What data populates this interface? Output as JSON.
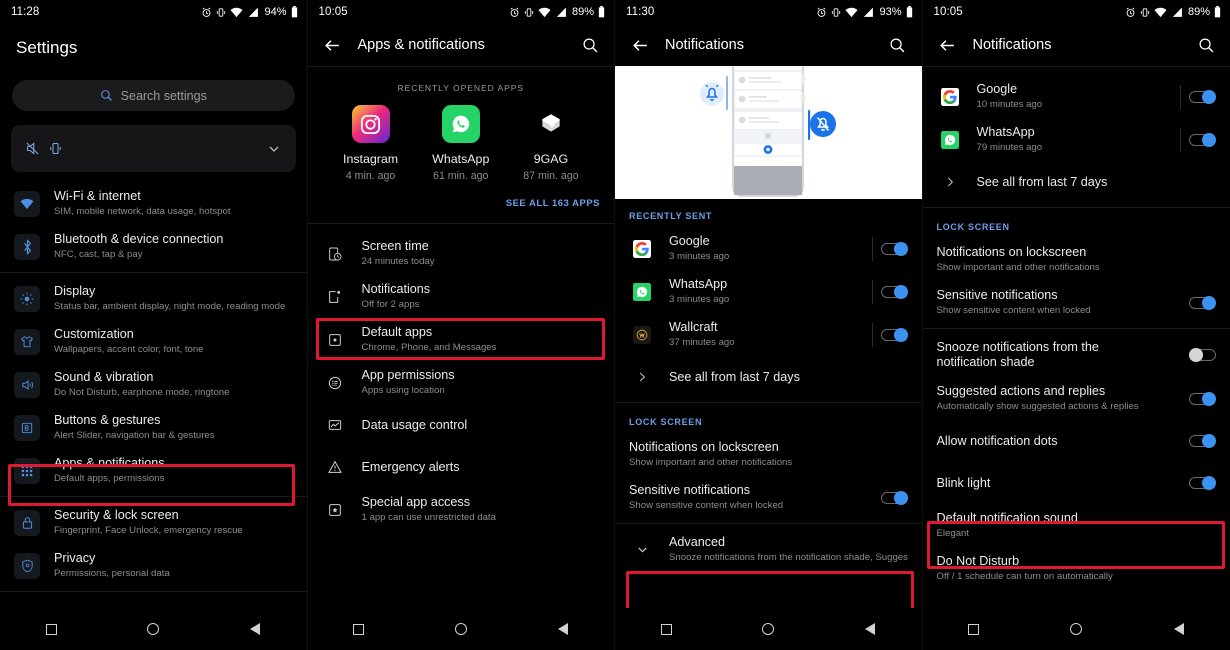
{
  "panels": [
    {
      "id": "settings",
      "statusbar": {
        "time": "11:28",
        "battery": "94%"
      },
      "title": "Settings",
      "search": {
        "placeholder": "Search settings"
      },
      "quick_card": {
        "icons": [
          "mute-icon",
          "vibrate-icon"
        ],
        "chevron": "chevron-down-icon"
      },
      "items": [
        {
          "title": "Wi-Fi & internet",
          "subtitle": "SIM, mobile network, data usage, hotspot",
          "icon": "wifi-icon"
        },
        {
          "title": "Bluetooth & device connection",
          "subtitle": "NFC, cast, tap & pay",
          "icon": "bluetooth-icon"
        },
        {
          "title": "Display",
          "subtitle": "Status bar, ambient display, night mode, reading mode",
          "icon": "brightness-icon"
        },
        {
          "title": "Customization",
          "subtitle": "Wallpapers, accent color, font, tone",
          "icon": "shirt-icon"
        },
        {
          "title": "Sound & vibration",
          "subtitle": "Do Not Disturb, earphone mode, ringtone",
          "icon": "volume-icon"
        },
        {
          "title": "Buttons & gestures",
          "subtitle": "Alert Slider, navigation bar & gestures",
          "icon": "buttons-icon"
        },
        {
          "title": "Apps & notifications",
          "subtitle": "Default apps, permissions",
          "icon": "apps-grid-icon",
          "highlighted": true
        },
        {
          "title": "Security & lock screen",
          "subtitle": "Fingerprint, Face Unlock, emergency rescue",
          "icon": "lock-icon"
        },
        {
          "title": "Privacy",
          "subtitle": "Permissions, personal data",
          "icon": "shield-icon"
        }
      ]
    },
    {
      "id": "apps-notifications",
      "statusbar": {
        "time": "10:05",
        "battery": "89%"
      },
      "title": "Apps & notifications",
      "recently_opened_label": "RECENTLY OPENED APPS",
      "recent_apps": [
        {
          "name": "Instagram",
          "time": "4 min. ago",
          "icon": "instagram-icon"
        },
        {
          "name": "WhatsApp",
          "time": "61 min. ago",
          "icon": "whatsapp-icon"
        },
        {
          "name": "9GAG",
          "time": "87 min. ago",
          "icon": "9gag-icon"
        }
      ],
      "see_all": "SEE ALL 163 APPS",
      "items": [
        {
          "title": "Screen time",
          "subtitle": "24 minutes today",
          "icon": "screen-time-icon"
        },
        {
          "title": "Notifications",
          "subtitle": "Off for 2 apps",
          "icon": "notifications-icon",
          "highlighted": true
        },
        {
          "title": "Default apps",
          "subtitle": "Chrome, Phone, and Messages",
          "icon": "default-apps-icon"
        },
        {
          "title": "App permissions",
          "subtitle": "Apps using location",
          "icon": "permissions-icon"
        },
        {
          "title": "Data usage control",
          "subtitle": "",
          "icon": "data-usage-icon"
        },
        {
          "title": "Emergency alerts",
          "subtitle": "",
          "icon": "warning-icon"
        },
        {
          "title": "Special app access",
          "subtitle": "1 app can use unrestricted data",
          "icon": "star-box-icon"
        }
      ]
    },
    {
      "id": "notifications-collapsed",
      "statusbar": {
        "time": "11:30",
        "battery": "93%"
      },
      "title": "Notifications",
      "illustration": "notification-shade-illustration",
      "recently_sent_label": "RECENTLY SENT",
      "recent_sent": [
        {
          "name": "Google",
          "time": "3 minutes ago",
          "icon": "google-icon",
          "toggle": "on"
        },
        {
          "name": "WhatsApp",
          "time": "3 minutes ago",
          "icon": "whatsapp-icon",
          "toggle": "on"
        },
        {
          "name": "Wallcraft",
          "time": "37 minutes ago",
          "icon": "wallcraft-icon",
          "toggle": "on"
        }
      ],
      "see_all_row": "See all from last 7 days",
      "lock_screen_label": "LOCK SCREEN",
      "lock_items": [
        {
          "title": "Notifications on lockscreen",
          "subtitle": "Show important and other notifications",
          "toggle": null
        },
        {
          "title": "Sensitive notifications",
          "subtitle": "Show sensitive content when locked",
          "toggle": "on"
        }
      ],
      "advanced": {
        "title": "Advanced",
        "subtitle": "Snooze notifications from the notification shade, Suggested ac..",
        "icon": "chevron-down-icon",
        "highlighted": true
      }
    },
    {
      "id": "notifications-expanded",
      "statusbar": {
        "time": "10:05",
        "battery": "89%"
      },
      "title": "Notifications",
      "recent_sent": [
        {
          "name": "Google",
          "time": "10 minutes ago",
          "icon": "google-icon",
          "toggle": "on"
        },
        {
          "name": "WhatsApp",
          "time": "79 minutes ago",
          "icon": "whatsapp-icon",
          "toggle": "on"
        }
      ],
      "see_all_row": "See all from last 7 days",
      "lock_screen_label": "LOCK SCREEN",
      "items": [
        {
          "title": "Notifications on lockscreen",
          "subtitle": "Show important and other notifications",
          "toggle": null
        },
        {
          "title": "Sensitive notifications",
          "subtitle": "Show sensitive content when locked",
          "toggle": "on"
        },
        {
          "title": "Snooze notifications from the notification shade",
          "subtitle": "",
          "toggle": "off",
          "twoline": true
        },
        {
          "title": "Suggested actions and replies",
          "subtitle": "Automatically show suggested actions & replies",
          "toggle": "on"
        },
        {
          "title": "Allow notification dots",
          "subtitle": "",
          "toggle": "on"
        },
        {
          "title": "Blink light",
          "subtitle": "",
          "toggle": "on"
        },
        {
          "title": "Default notification sound",
          "subtitle": "Elegant",
          "toggle": null,
          "highlighted": true
        },
        {
          "title": "Do Not Disturb",
          "subtitle": "Off / 1 schedule can turn on automatically",
          "toggle": null
        }
      ]
    }
  ],
  "navbar": {
    "recents": "square-icon",
    "home": "circle-icon",
    "back": "triangle-back-icon"
  },
  "colors": {
    "accent_blue": "#3b92f0",
    "section_blue": "#6f9fe8",
    "highlight_red": "#e01933",
    "background": "#000000",
    "text_primary": "#ececec",
    "text_secondary": "#8d8d91"
  }
}
